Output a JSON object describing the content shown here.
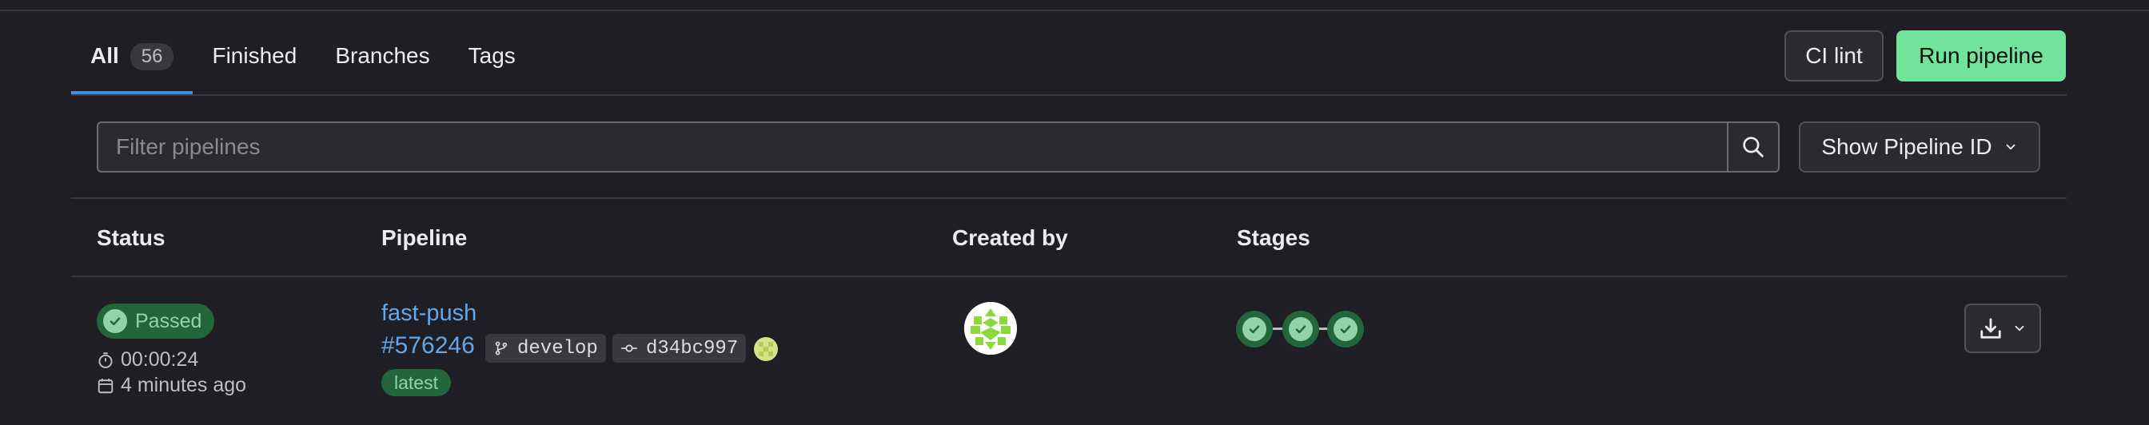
{
  "tabs": [
    {
      "label": "All",
      "count": "56"
    },
    {
      "label": "Finished"
    },
    {
      "label": "Branches"
    },
    {
      "label": "Tags"
    }
  ],
  "toolbar": {
    "ci_lint": "CI lint",
    "run_pipeline": "Run pipeline"
  },
  "filter": {
    "placeholder": "Filter pipelines",
    "show_id": "Show Pipeline ID"
  },
  "table": {
    "headers": {
      "status": "Status",
      "pipeline": "Pipeline",
      "created_by": "Created by",
      "stages": "Stages"
    },
    "rows": [
      {
        "status": "Passed",
        "duration": "00:00:24",
        "finished": "4 minutes ago",
        "name": "fast-push",
        "id": "#576246",
        "branch": "develop",
        "commit": "d34bc997",
        "tag": "latest",
        "stages": [
          "passed",
          "passed",
          "passed"
        ]
      }
    ]
  },
  "colors": {
    "accent": "#428fdc",
    "success": "#91d4a8",
    "success_bg": "#24663b",
    "run_button": "#72e39a"
  }
}
